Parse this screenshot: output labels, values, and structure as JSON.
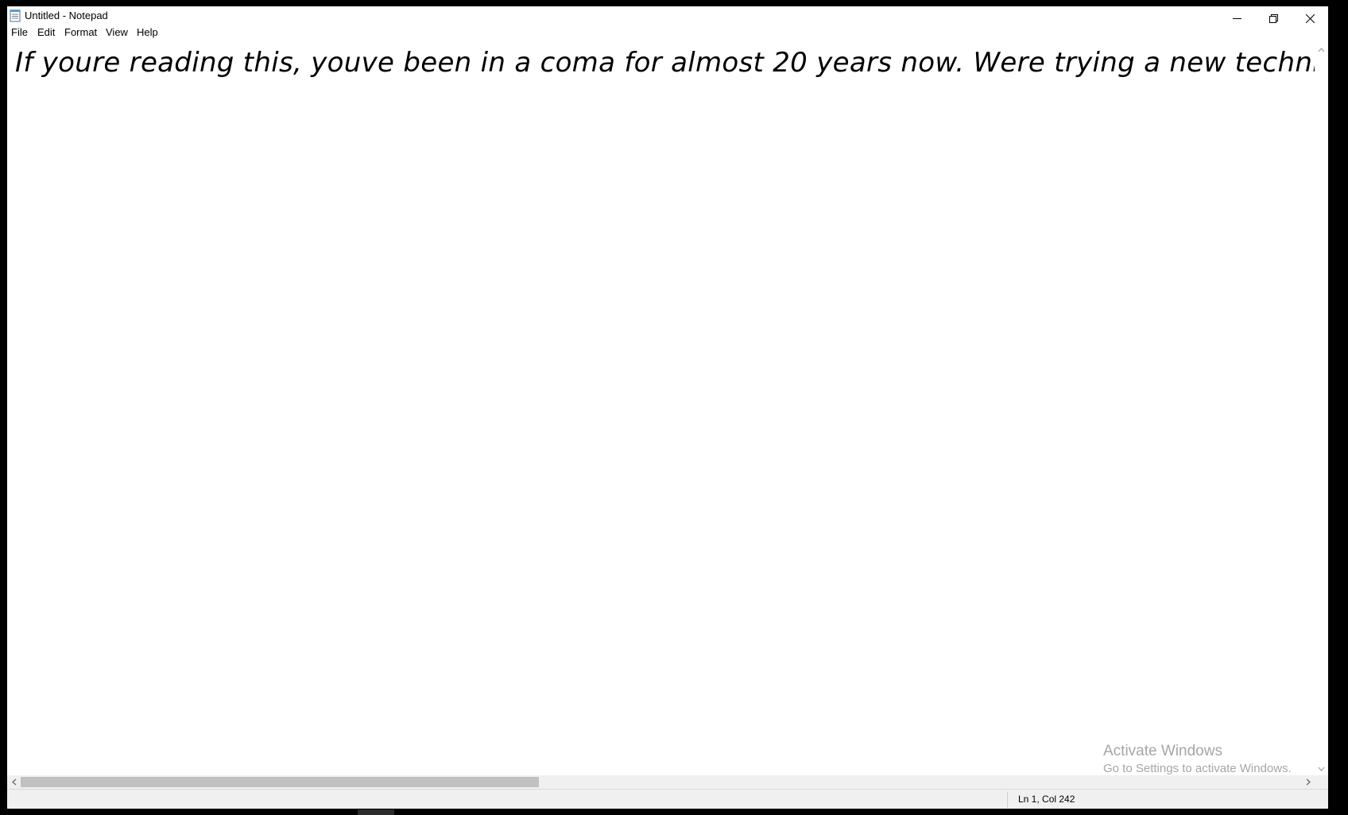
{
  "window": {
    "title": "Untitled - Notepad",
    "icon": "notepad-icon",
    "controls": {
      "minimize_icon": "minimize-icon",
      "restore_icon": "restore-icon",
      "close_icon": "close-icon"
    }
  },
  "menubar": {
    "items": [
      {
        "label": "File"
      },
      {
        "label": "Edit"
      },
      {
        "label": "Format"
      },
      {
        "label": "View"
      },
      {
        "label": "Help"
      }
    ]
  },
  "editor": {
    "content": "If youre reading this, youve been in a coma for almost 20 years now. Were trying a new technique."
  },
  "scrollbars": {
    "horizontal": {
      "thumb_fraction": 0.405,
      "scroll_position": 0.0
    }
  },
  "statusbar": {
    "cursor_position": "Ln 1, Col 242"
  },
  "watermark": {
    "title": "Activate Windows",
    "subtitle": "Go to Settings to activate Windows."
  },
  "colors": {
    "background": "#ffffff",
    "frame": "#000000",
    "statusbar": "#f0f0f0",
    "scrollbar_thumb": "#c1c1c1",
    "watermark_text": "#a6a6a6"
  }
}
